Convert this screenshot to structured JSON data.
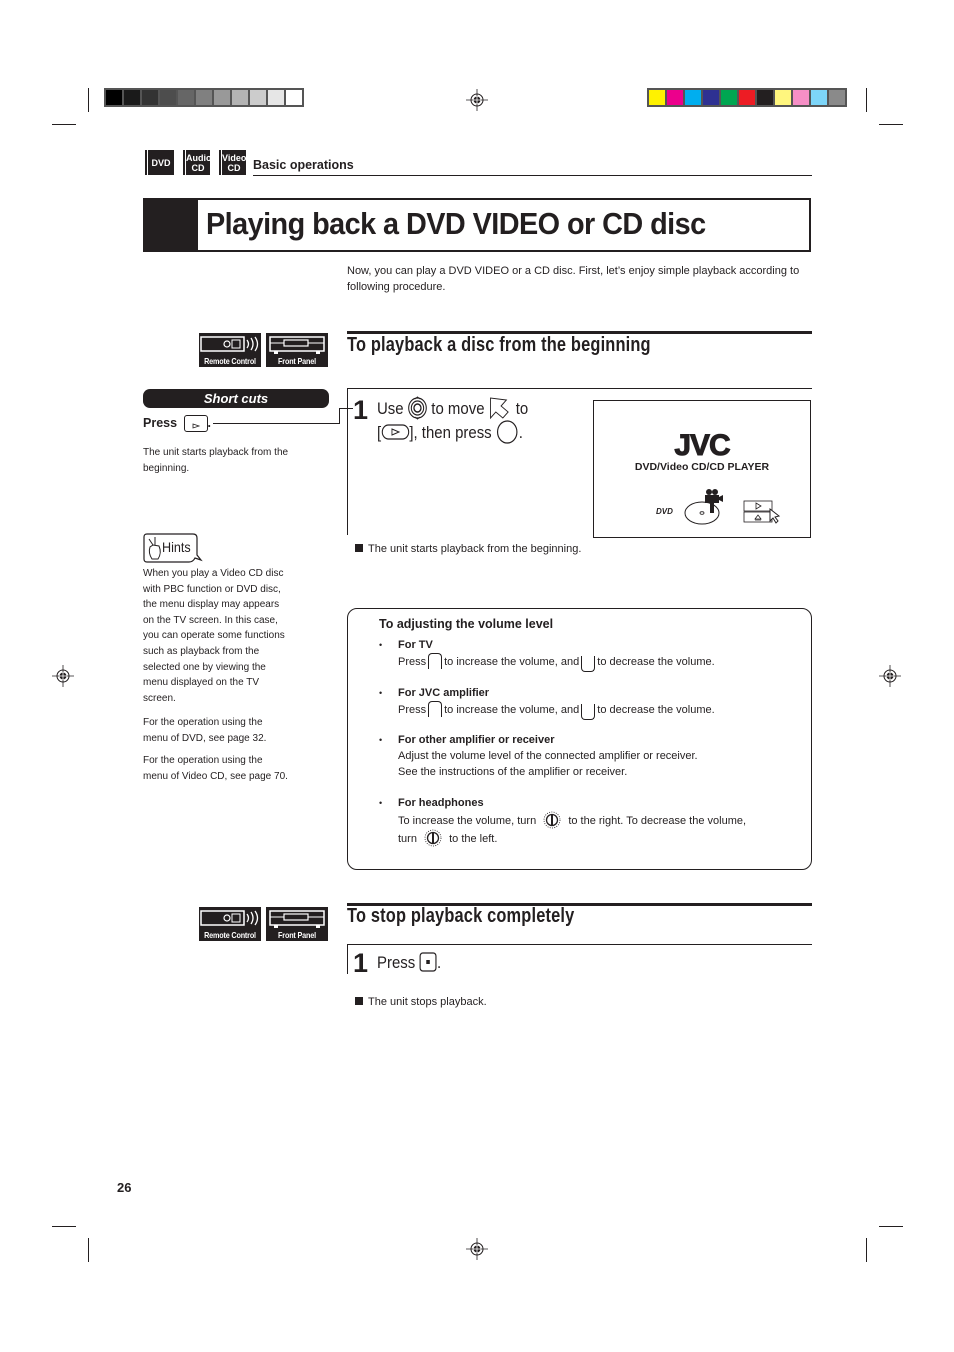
{
  "print_marks": {
    "grayscale_bar": [
      "#000000",
      "#1a1a1a",
      "#333333",
      "#4d4d4d",
      "#666666",
      "#808080",
      "#999999",
      "#b3b3b3",
      "#cccccc",
      "#e6e6e6",
      "#ffffff"
    ],
    "color_bar": [
      "#fff200",
      "#ec008c",
      "#00aeef",
      "#2e3192",
      "#00a651",
      "#ed1c24",
      "#231f20",
      "#fff67e",
      "#f68fc6",
      "#7dd5f8",
      "#8a8a8a"
    ]
  },
  "header": {
    "badges": [
      {
        "line1": "DVD",
        "line2": ""
      },
      {
        "line1": "Audio",
        "line2": "CD"
      },
      {
        "line1": "Video",
        "line2": "CD"
      }
    ],
    "section": "Basic operations"
  },
  "page_title": "Playing back a DVD VIDEO or CD disc",
  "intro": "Now, you can play a DVD VIDEO or a CD disc.  First, let’s enjoy simple playback according to following procedure.",
  "control_icons": {
    "remote": "Remote Control",
    "front": "Front Panel"
  },
  "section1": {
    "title": "To playback a disc from the beginning",
    "shortcuts": {
      "label": "Short cuts",
      "press": "Press",
      "period": ".",
      "description": "The unit starts playback from the beginning."
    },
    "step": {
      "number": "1",
      "use": "Use",
      "to_move": "to move",
      "to": "to",
      "open_bracket": "[",
      "then_press": "], then press",
      "period": "."
    },
    "screen": {
      "brand": "JVC",
      "subtitle": "DVD/Video CD/CD PLAYER",
      "dvd_logo": "DVD"
    },
    "result": "The unit starts playback from the beginning."
  },
  "hints": {
    "label": "Hints",
    "paragraphs": [
      [
        "When you play a Video CD disc",
        "with PBC function or DVD disc,",
        "the menu display may appears",
        "on the TV screen. In this case,",
        "you can operate some functions",
        "such as playback from the",
        "selected one by viewing the",
        "menu displayed on the TV",
        "screen."
      ],
      [
        "For the operation using the",
        "menu of DVD, see page 32."
      ],
      [
        "For the operation using the",
        "menu of Video CD, see page 70."
      ]
    ]
  },
  "volume": {
    "title": "To adjusting the volume level",
    "bullet": "•",
    "items": [
      {
        "head": "For TV",
        "press": "Press",
        "inc": "to increase the volume, and",
        "dec": "to decrease the volume."
      },
      {
        "head": "For JVC amplifier",
        "press": "Press",
        "inc": "to increase the volume, and",
        "dec": "to decrease the volume."
      },
      {
        "head": "For other amplifier or receiver",
        "line1": "Adjust the volume level of the connected amplifier or receiver.",
        "line2": "See the instructions of the amplifier or receiver."
      },
      {
        "head": "For headphones",
        "part1": "To increase the volume, turn",
        "part2": "to the right. To decrease the volume,",
        "part3": "turn",
        "part4": "to the left."
      }
    ]
  },
  "section2": {
    "title": "To stop playback completely",
    "step": {
      "number": "1",
      "press": "Press",
      "period": "."
    },
    "result": "The unit stops playback."
  },
  "page_number": "26"
}
